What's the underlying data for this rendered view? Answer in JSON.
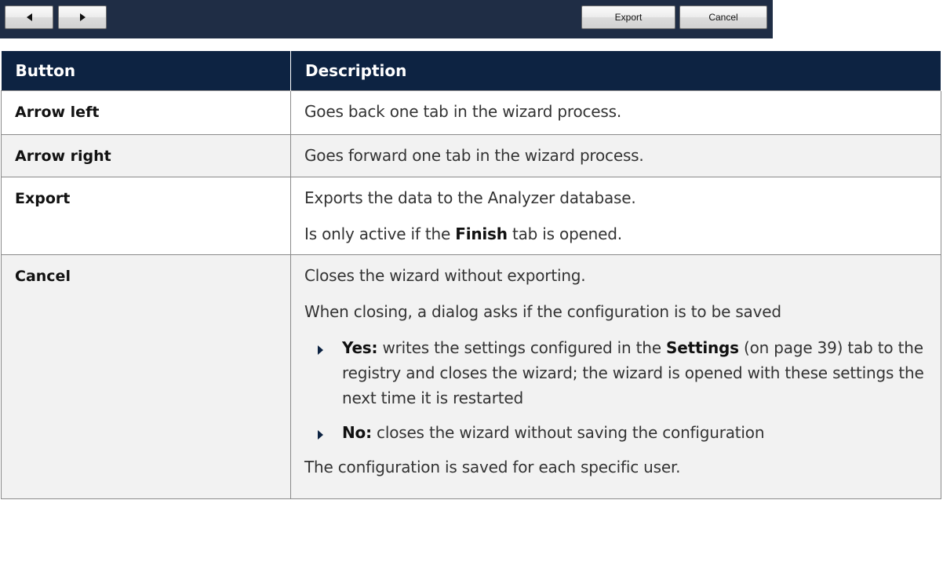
{
  "toolbar": {
    "prev_icon": "arrow-left-icon",
    "next_icon": "arrow-right-icon",
    "export_label": "Export",
    "cancel_label": "Cancel",
    "background": "#1f2d45"
  },
  "table": {
    "header_background": "#0d2342",
    "headers": {
      "button": "Button",
      "description": "Description"
    },
    "rows": [
      {
        "name": "Arrow left",
        "desc": "Goes back one tab in the wizard process."
      },
      {
        "name": "Arrow right",
        "desc": "Goes forward one tab in the wizard process."
      },
      {
        "name": "Export",
        "desc": "Exports the data to the Analyzer database.",
        "desc2_pre": "Is only active if the ",
        "desc2_bold": "Finish",
        "desc2_post": " tab is opened."
      },
      {
        "name": "Cancel",
        "desc": "Closes the wizard without exporting.",
        "desc2": "When closing, a dialog asks if the configuration is to be saved",
        "bullets": [
          {
            "label": "Yes:",
            "pre": " writes the settings configured in the ",
            "link": "Settings",
            "post": " (on page 39) tab to the registry and closes the wizard; the wizard is opened with these settings the next time it is restarted"
          },
          {
            "label": "No:",
            "pre": " closes the wizard without saving the configuration",
            "link": "",
            "post": ""
          }
        ],
        "desc3": "The configuration is saved for each specific user."
      }
    ]
  }
}
